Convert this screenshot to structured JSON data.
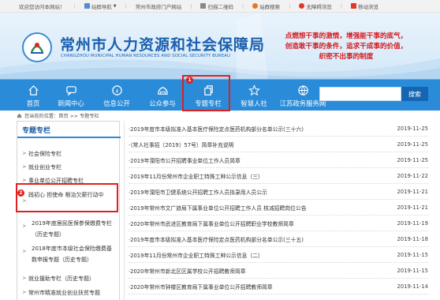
{
  "topbar": {
    "items": [
      "欢迎您访问本网站！",
      "站群导航",
      "常州市政府门户网站",
      "扫描二维码",
      "站群搜索",
      "无障碍浏览",
      "移动浏览"
    ],
    "colors": {
      "accent": "#2a8bd8"
    }
  },
  "header": {
    "title": "常州市人力资源和社会保障局",
    "subtitle": "CHANGZHOU MUNICIPAL HUMAN RESOURCES AND SOCIAL SECURITY BUREAU",
    "slogan": [
      "点燃想干事的激情，增强能干事的底气，",
      "创造敢干事的条件，追求干成事的价值，",
      "织密不出事的制度"
    ]
  },
  "nav": {
    "items": [
      {
        "label": "首页",
        "icon": "home-icon"
      },
      {
        "label": "新闻中心",
        "icon": "chat-icon"
      },
      {
        "label": "信息公开",
        "icon": "info-icon"
      },
      {
        "label": "公众参与",
        "icon": "people-icon"
      },
      {
        "label": "专题专栏",
        "icon": "pages-icon"
      },
      {
        "label": "智慧人社",
        "icon": "star-icon"
      },
      {
        "label": "江苏政务服务网",
        "icon": "globe-icon"
      }
    ],
    "search_button": "搜索",
    "search_placeholder": ""
  },
  "breadcrumb": "您当前的位置：首页 >> 专题专栏",
  "sidebar": {
    "heading": "专题专栏",
    "items": [
      "社会保险专栏",
      "就业创业专栏",
      "事业单位公开招聘专栏",
      "践初心 担使命 根治欠薪行动中",
      "2019年度居民医保参保缴费专栏（历史专题）",
      "2018年度市本级社会保险缴费基数申报专题（历史专题）",
      "就业援助专栏（历史专题）",
      "常州市精准就业创业扶贫专题"
    ]
  },
  "annotations": [
    "1",
    "2"
  ],
  "list": {
    "rows": [
      {
        "title": "·2019年度市本级拟准入基本医疗保险定点医药机构部分名单公示(三十六)",
        "date": "2019-11-25"
      },
      {
        "title": "·（常人社事招〔2019〕57号）简章补充说明",
        "date": "2019-11-25"
      },
      {
        "title": "·2019年溧阳市公开招聘事业单位工作人员简章",
        "date": "2019-11-25"
      },
      {
        "title": "·2019年11月份常州市企业职工特殊工种公示信息（三）",
        "date": "2019-11-22"
      },
      {
        "title": "·2019年溧阳市卫健系统公开招聘工作人员拟录用人员公示",
        "date": "2019-11-21"
      },
      {
        "title": "·2019年常州市文广旅局下属事业单位公开招聘工作人员 核减招聘岗位公告",
        "date": "2019-11-21"
      },
      {
        "title": "·2020年常州市武进区教育局下属事业单位公开招聘职业学校教师简章",
        "date": "2019-11-19"
      },
      {
        "title": "·2019年度市本级拟准入基本医疗保险定点医药机构部分名单公示(三十五)",
        "date": "2019-11-18"
      },
      {
        "title": "·2019年11月份常州市企业职工特殊工种公示信息（二）",
        "date": "2019-11-15"
      },
      {
        "title": "·2020年常州市新北区区属学校公开招聘教师简章",
        "date": "2019-11-15"
      },
      {
        "title": "·2020年常州市钟楼区教育局下属事业单位公开招聘教师简章",
        "date": "2019-11-14"
      }
    ]
  }
}
